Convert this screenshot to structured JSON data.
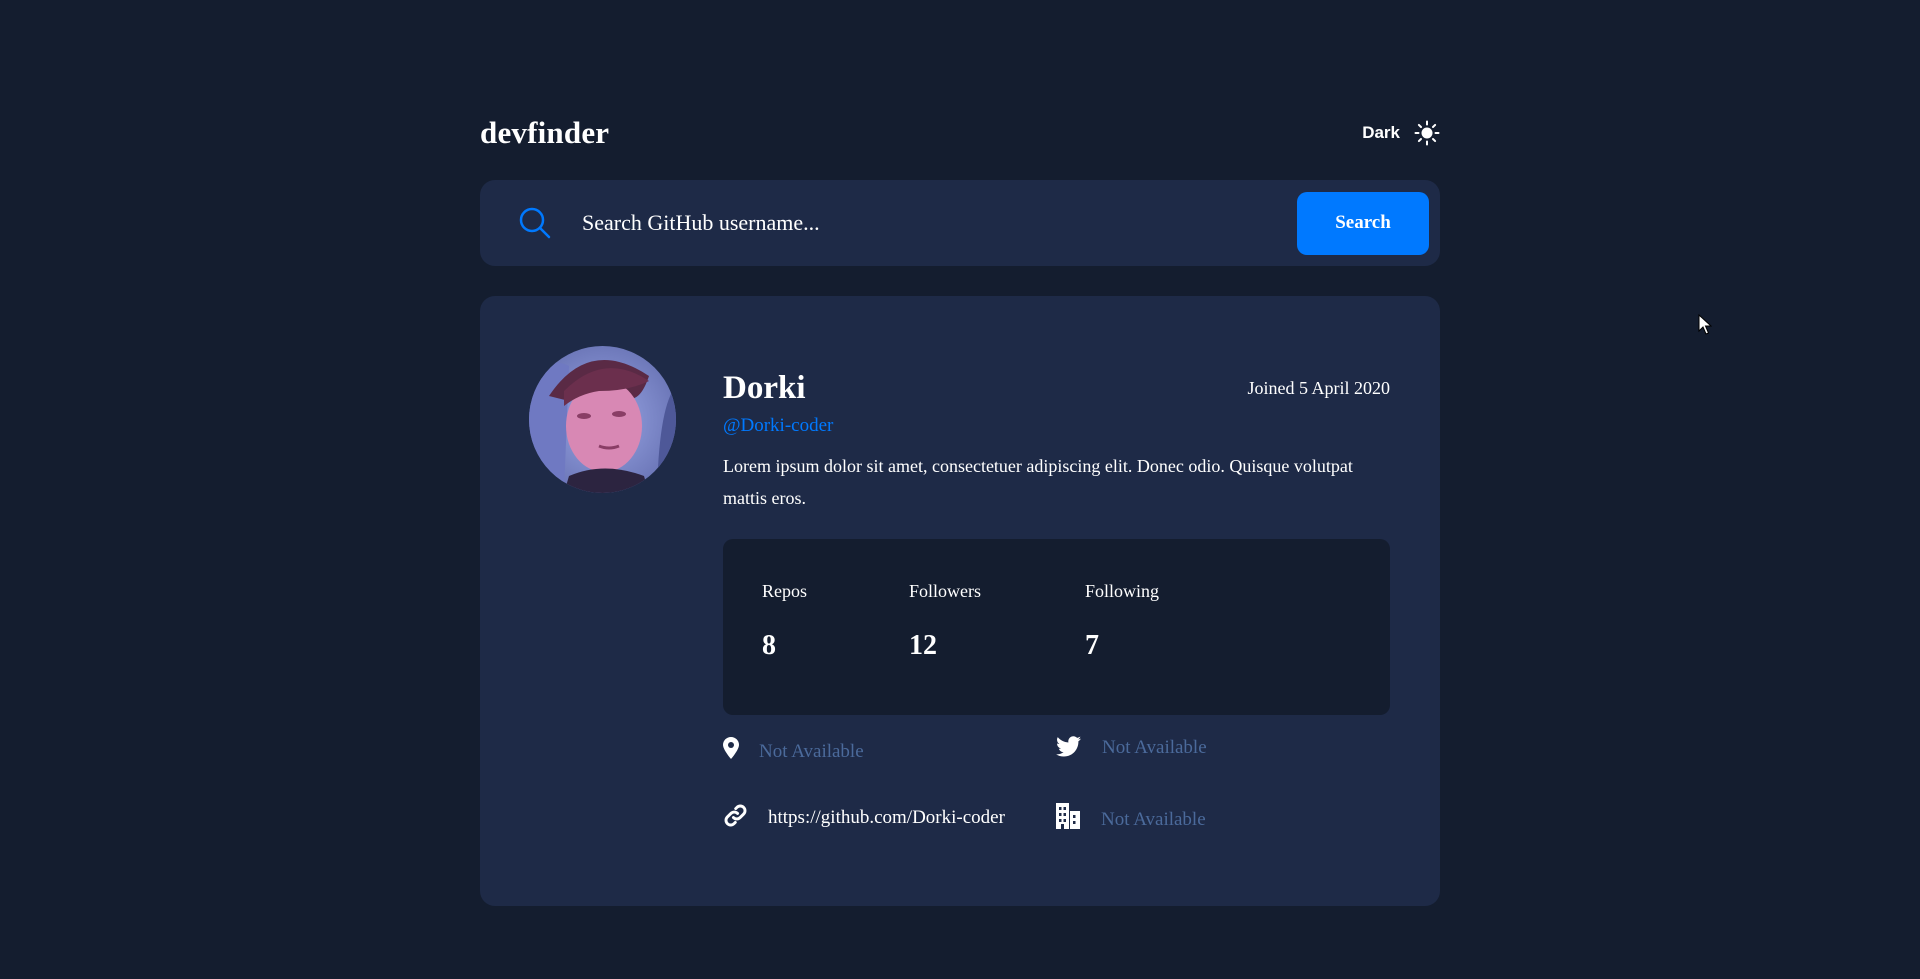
{
  "header": {
    "brand": "devfinder",
    "theme_label": "Dark",
    "theme_icon": "sun-icon"
  },
  "search": {
    "icon": "search-icon",
    "placeholder": "Search GitHub username...",
    "value": "",
    "button_label": "Search"
  },
  "profile": {
    "name": "Dorki",
    "login": "@Dorki-coder",
    "joined": "Joined 5 April 2020",
    "bio": "Lorem ipsum dolor sit amet, consectetuer adipiscing elit. Donec odio. Quisque volutpat mattis eros."
  },
  "stats": {
    "repos_label": "Repos",
    "repos_value": "8",
    "followers_label": "Followers",
    "followers_value": "12",
    "following_label": "Following",
    "following_value": "7"
  },
  "links": {
    "location": {
      "icon": "location-pin-icon",
      "text": "Not Available"
    },
    "twitter": {
      "icon": "twitter-icon",
      "text": "Not Available"
    },
    "blog": {
      "icon": "link-icon",
      "text": "https://github.com/Dorki-coder"
    },
    "company": {
      "icon": "building-icon",
      "text": "Not Available"
    }
  },
  "colors": {
    "page_background": "#141d2f",
    "card_background": "#1e2a47",
    "accent": "#0079ff",
    "muted": "#4b6a9b",
    "text": "#ffffff"
  }
}
